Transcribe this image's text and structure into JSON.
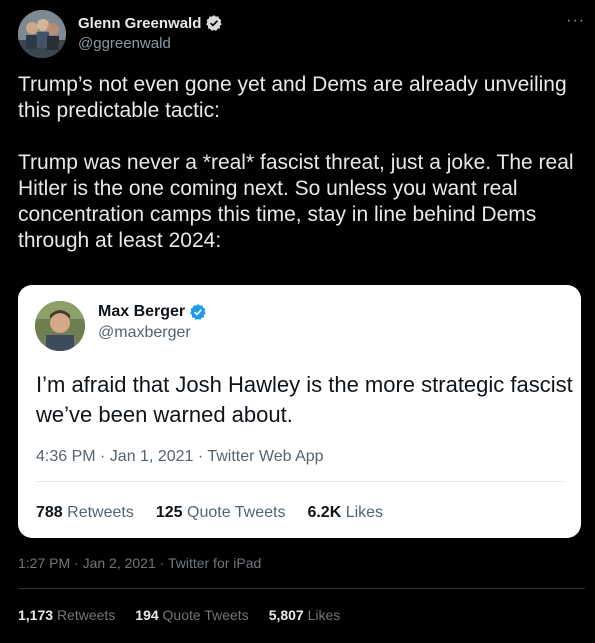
{
  "author": {
    "name": "Glenn Greenwald",
    "handle": "@ggreenwald"
  },
  "tweet_text": "Trump’s not even gone yet and Dems are already unveiling this predictable tactic:\n\nTrump was never a *real* fascist threat, just a joke. The real Hitler is the one coming next. So unless you want real concentration camps this time, stay in line behind Dems through at least 2024:",
  "more_icon": "···",
  "quoted_tweet": {
    "name": "Max Berger",
    "handle": "@maxberger",
    "text": "I’m afraid that Josh Hawley is the more strategic fascist we’ve been warned about.",
    "meta": "4:36 PM · Jan 1, 2021 · Twitter Web App",
    "retweets_count": "788",
    "retweets_label": "Retweets",
    "quotes_count": "125",
    "quotes_label": "Quote Tweets",
    "likes_count": "6.2K",
    "likes_label": "Likes"
  },
  "meta": "1:27 PM · Jan 2, 2021 · Twitter for iPad",
  "stats": {
    "retweets_count": "1,173",
    "retweets_label": "Retweets",
    "quotes_count": "194",
    "quotes_label": "Quote Tweets",
    "likes_count": "5,807",
    "likes_label": "Likes"
  },
  "colors": {
    "background": "#000000",
    "verified": "#1d9bf0",
    "quote_card": "#ffffff"
  }
}
